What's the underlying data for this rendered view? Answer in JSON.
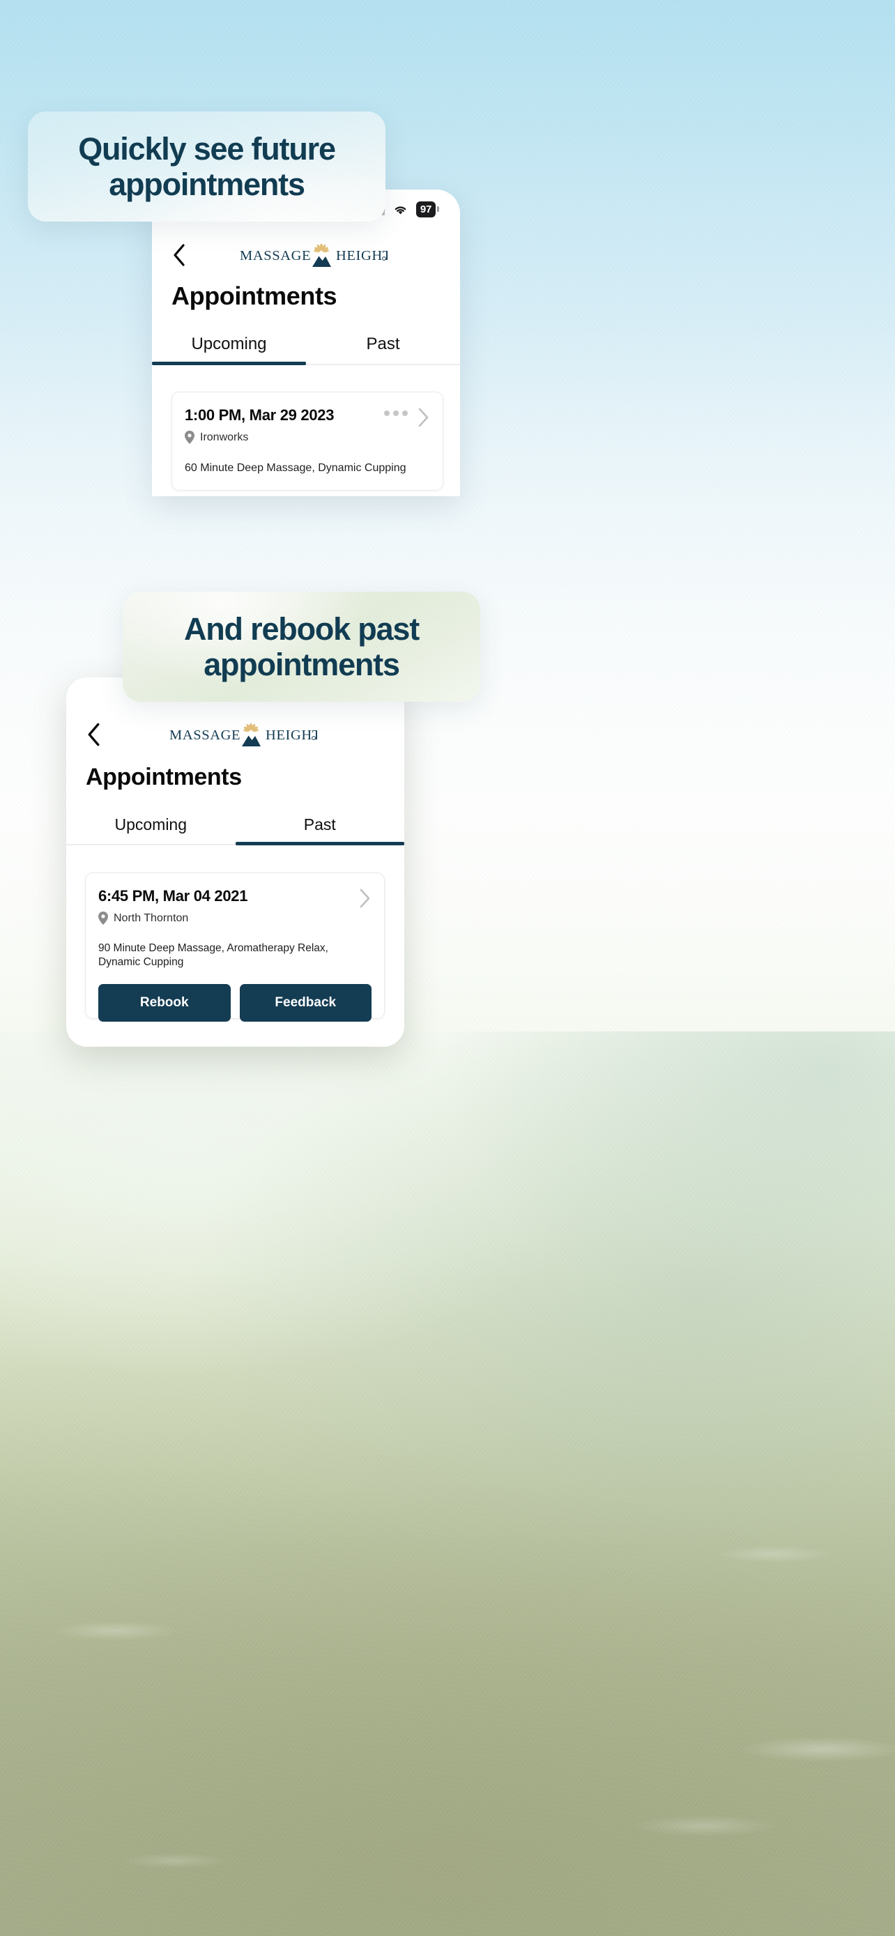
{
  "background": {
    "top_color": "#b3e0f0",
    "mid_color": "#fbfdfd",
    "bottom_color": "#a4ad89"
  },
  "brand": {
    "name_left": "MASSAGE",
    "name_right": "HEIGHTS",
    "registered_mark": "®",
    "navy": "#143c53",
    "gold": "#e3c07a"
  },
  "callouts": [
    {
      "line1": "Quickly see future",
      "line2": "appointments",
      "color": "#113c52"
    },
    {
      "line1": "And rebook past",
      "line2": "appointments",
      "color": "#113c52"
    }
  ],
  "screens": [
    {
      "id": "upcoming",
      "status_bar": {
        "battery_percent": "97",
        "signal_bars": 4,
        "wifi": "wifi-icon"
      },
      "nav": {
        "back": "chevron-left-icon"
      },
      "title": "Appointments",
      "tabs": [
        {
          "label": "Upcoming",
          "active": true
        },
        {
          "label": "Past",
          "active": false
        }
      ],
      "appointments": [
        {
          "time": "1:00 PM, Mar 29 2023",
          "location": "Ironworks",
          "services": "60 Minute Deep Massage, Dynamic Cupping",
          "has_overflow_menu": true,
          "actions": []
        }
      ]
    },
    {
      "id": "past",
      "status_bar": null,
      "nav": {
        "back": "chevron-left-icon"
      },
      "title": "Appointments",
      "tabs": [
        {
          "label": "Upcoming",
          "active": false
        },
        {
          "label": "Past",
          "active": true
        }
      ],
      "appointments": [
        {
          "time": "6:45 PM, Mar 04 2021",
          "location": "North Thornton",
          "services": "90 Minute Deep Massage, Aromatherapy Relax, Dynamic Cupping",
          "has_overflow_menu": false,
          "actions": [
            "Rebook",
            "Feedback"
          ]
        }
      ]
    }
  ]
}
